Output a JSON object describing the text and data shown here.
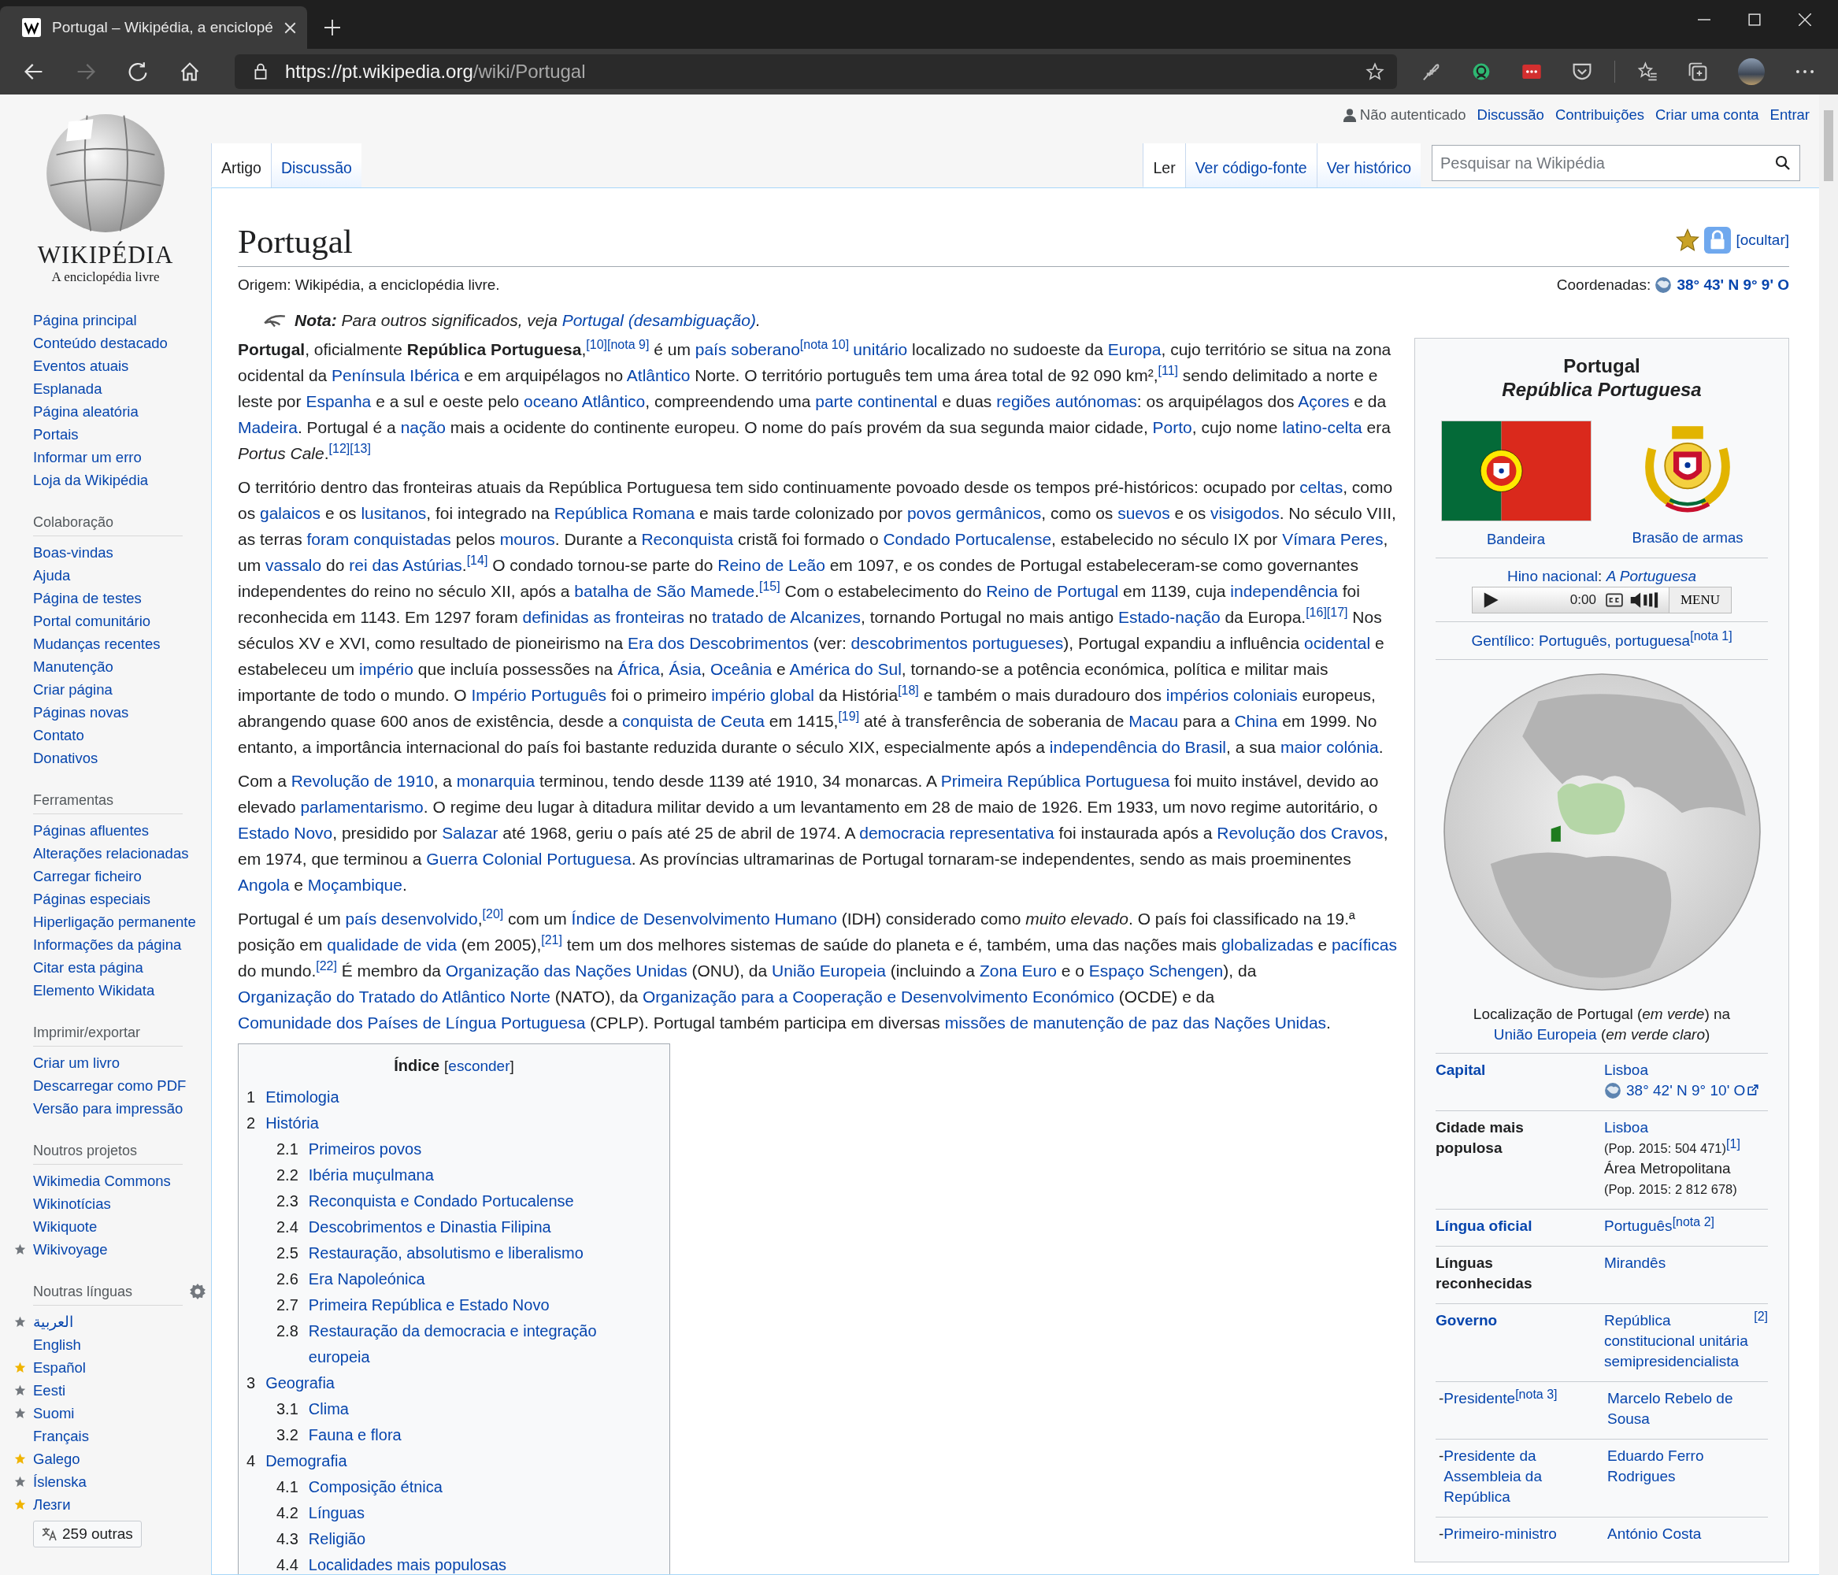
{
  "browser": {
    "tab": {
      "title": "Portugal – Wikipédia, a enciclopé"
    },
    "forward_disabled": true,
    "url": {
      "host": "https://pt.wikipedia.org",
      "path": "/wiki/Portugal"
    }
  },
  "personal": {
    "user": "Não autenticado",
    "links": [
      "Discussão",
      "Contribuições",
      "Criar uma conta",
      "Entrar"
    ]
  },
  "left_tabs": [
    {
      "label": "Artigo",
      "selected": true
    },
    {
      "label": "Discussão",
      "selected": false
    }
  ],
  "right_tabs": [
    {
      "label": "Ler",
      "selected": true
    },
    {
      "label": "Ver código-fonte",
      "selected": false
    },
    {
      "label": "Ver histórico",
      "selected": false
    }
  ],
  "search": {
    "placeholder": "Pesquisar na Wikipédia"
  },
  "sidebar": {
    "logo": {
      "wordmark": "WIKIPÉDIA",
      "tagline": "A enciclopédia livre"
    },
    "groups": [
      {
        "items": [
          {
            "label": "Página principal"
          },
          {
            "label": "Conteúdo destacado"
          },
          {
            "label": "Eventos atuais"
          },
          {
            "label": "Esplanada"
          },
          {
            "label": "Página aleatória"
          },
          {
            "label": "Portais"
          },
          {
            "label": "Informar um erro"
          },
          {
            "label": "Loja da Wikipédia"
          }
        ]
      },
      {
        "heading": "Colaboração",
        "items": [
          {
            "label": "Boas-vindas"
          },
          {
            "label": "Ajuda"
          },
          {
            "label": "Página de testes"
          },
          {
            "label": "Portal comunitário"
          },
          {
            "label": "Mudanças recentes"
          },
          {
            "label": "Manutenção"
          },
          {
            "label": "Criar página"
          },
          {
            "label": "Páginas novas"
          },
          {
            "label": "Contato"
          },
          {
            "label": "Donativos"
          }
        ]
      },
      {
        "heading": "Ferramentas",
        "items": [
          {
            "label": "Páginas afluentes"
          },
          {
            "label": "Alterações relacionadas"
          },
          {
            "label": "Carregar ficheiro"
          },
          {
            "label": "Páginas especiais"
          },
          {
            "label": "Hiperligação permanente"
          },
          {
            "label": "Informações da página"
          },
          {
            "label": "Citar esta página"
          },
          {
            "label": "Elemento Wikidata"
          }
        ]
      },
      {
        "heading": "Imprimir/exportar",
        "items": [
          {
            "label": "Criar um livro"
          },
          {
            "label": "Descarregar como PDF"
          },
          {
            "label": "Versão para impressão"
          }
        ]
      },
      {
        "heading": "Noutros projetos",
        "items": [
          {
            "label": "Wikimedia Commons"
          },
          {
            "label": "Wikinotícias"
          },
          {
            "label": "Wikiquote"
          },
          {
            "label": "Wikivoyage",
            "color": "#72777d"
          }
        ]
      },
      {
        "heading": "Noutras línguas",
        "settings": true,
        "more": "259 outras",
        "items": [
          {
            "label": "العربية",
            "color": "#72777d"
          },
          {
            "label": "English"
          },
          {
            "label": "Español",
            "color": "#f0b400"
          },
          {
            "label": "Eesti",
            "color": "#72777d"
          },
          {
            "label": "Suomi",
            "color": "#72777d"
          },
          {
            "label": "Français"
          },
          {
            "label": "Galego",
            "color": "#f0b400"
          },
          {
            "label": "Íslenska",
            "color": "#72777d"
          },
          {
            "label": "Лезги",
            "color": "#f0b400"
          }
        ]
      }
    ]
  },
  "article": {
    "title": "Portugal",
    "hide_link": "[ocultar]",
    "origin": "Origem: Wikipédia, a enciclopédia livre.",
    "coordinates": [
      "Coordenadas: ",
      {
        "kind": "coord",
        "text": "38° 43' N 9° 9' O"
      }
    ],
    "hatnote": [
      "**Nota:** Para outros significados, veja ",
      {
        "kind": "link",
        "text": "Portugal (desambiguação)"
      },
      "."
    ],
    "paragraphs": [
      [
        "**Portugal**, oficialmente **República Portuguesa**,",
        {
          "kind": "ref",
          "text": "[10]"
        },
        {
          "kind": "ref",
          "text": "[nota 9]"
        },
        " é um ",
        {
          "kind": "link",
          "text": "país soberano"
        },
        {
          "kind": "ref",
          "text": "[nota 10]"
        },
        {
          "kind": "link",
          "text": "unitário"
        },
        " localizado no sudoeste da ",
        {
          "kind": "link",
          "text": "Europa"
        },
        ", cujo território se situa na zona ocidental da ",
        {
          "kind": "link",
          "text": "Península Ibérica"
        },
        " e em arquipélagos no ",
        {
          "kind": "link",
          "text": "Atlântico"
        },
        " Norte. O território português tem uma área total de 92 090 km²,",
        {
          "kind": "ref",
          "text": "[11]"
        },
        " sendo delimitado a norte e leste por ",
        {
          "kind": "link",
          "text": "Espanha"
        },
        " e a sul e oeste pelo ",
        {
          "kind": "link",
          "text": "oceano Atlântico"
        },
        ", compreendendo uma ",
        {
          "kind": "link",
          "text": "parte continental"
        },
        " e duas ",
        {
          "kind": "link",
          "text": "regiões autónomas"
        },
        ": os arquipélagos dos ",
        {
          "kind": "link",
          "text": "Açores"
        },
        " e da ",
        {
          "kind": "link",
          "text": "Madeira"
        },
        ". Portugal é a ",
        {
          "kind": "link",
          "text": "nação"
        },
        " mais a ocidente do continente europeu. O nome do país provém da sua segunda maior cidade, ",
        {
          "kind": "link",
          "text": "Porto"
        },
        ", cujo nome ",
        {
          "kind": "link",
          "text": "latino-celta"
        },
        " era *Portus Cale*.",
        {
          "kind": "ref",
          "text": "[12]"
        },
        {
          "kind": "ref",
          "text": "[13]"
        }
      ],
      [
        "O território dentro das fronteiras atuais da República Portuguesa tem sido continuamente povoado desde os tempos pré-históricos: ocupado por ",
        {
          "kind": "link",
          "text": "celtas"
        },
        ", como os ",
        {
          "kind": "link",
          "text": "galaicos"
        },
        " e os ",
        {
          "kind": "link",
          "text": "lusitanos"
        },
        ", foi integrado na ",
        {
          "kind": "link",
          "text": "República Romana"
        },
        " e mais tarde colonizado por ",
        {
          "kind": "link",
          "text": "povos germânicos"
        },
        ", como os ",
        {
          "kind": "link",
          "text": "suevos"
        },
        " e os ",
        {
          "kind": "link",
          "text": "visigodos"
        },
        ". No século VIII, as terras ",
        {
          "kind": "link",
          "text": "foram conquistadas"
        },
        " pelos ",
        {
          "kind": "link",
          "text": "mouros"
        },
        ". Durante a ",
        {
          "kind": "link",
          "text": "Reconquista"
        },
        " cristã foi formado o ",
        {
          "kind": "link",
          "text": "Condado Portucalense"
        },
        ", estabelecido no século IX por ",
        {
          "kind": "link",
          "text": "Vímara Peres"
        },
        ", um ",
        {
          "kind": "link",
          "text": "vassalo"
        },
        " do ",
        {
          "kind": "link",
          "text": "rei das Astúrias"
        },
        ".",
        {
          "kind": "ref",
          "text": "[14]"
        },
        " O condado tornou-se parte do ",
        {
          "kind": "link",
          "text": "Reino de Leão"
        },
        " em 1097, e os condes de Portugal estabeleceram-se como governantes independentes do reino no século XII, após a ",
        {
          "kind": "link",
          "text": "batalha de São Mamede"
        },
        ".",
        {
          "kind": "ref",
          "text": "[15]"
        },
        " Com o estabelecimento do ",
        {
          "kind": "link",
          "text": "Reino de Portugal"
        },
        " em 1139, cuja ",
        {
          "kind": "link",
          "text": "independência"
        },
        " foi reconhecida em 1143. Em 1297 foram ",
        {
          "kind": "link",
          "text": "definidas as fronteiras"
        },
        " no ",
        {
          "kind": "link",
          "text": "tratado de Alcanizes"
        },
        ", tornando Portugal no mais antigo ",
        {
          "kind": "link",
          "text": "Estado-nação"
        },
        " da Europa.",
        {
          "kind": "ref",
          "text": "[16]"
        },
        {
          "kind": "ref",
          "text": "[17]"
        },
        " Nos séculos XV e XVI, como resultado de pioneirismo na ",
        {
          "kind": "link",
          "text": "Era dos Descobrimentos"
        },
        " (ver: ",
        {
          "kind": "link",
          "text": "descobrimentos portugueses"
        },
        "), Portugal expandiu a influência ",
        {
          "kind": "link",
          "text": "ocidental"
        },
        " e estabeleceu um ",
        {
          "kind": "link",
          "text": "império"
        },
        " que incluía possessões na ",
        {
          "kind": "link",
          "text": "África"
        },
        ", ",
        {
          "kind": "link",
          "text": "Ásia"
        },
        ", ",
        {
          "kind": "link",
          "text": "Oceânia"
        },
        " e ",
        {
          "kind": "link",
          "text": "América do Sul"
        },
        ", tornando-se a potência económica, política e militar mais importante de todo o mundo. O ",
        {
          "kind": "link",
          "text": "Império Português"
        },
        " foi o primeiro ",
        {
          "kind": "link",
          "text": "império global"
        },
        " da História",
        {
          "kind": "ref",
          "text": "[18]"
        },
        " e também o mais duradouro dos ",
        {
          "kind": "link",
          "text": "impérios coloniais"
        },
        " europeus, abrangendo quase 600 anos de existência, desde a ",
        {
          "kind": "link",
          "text": "conquista de Ceuta"
        },
        " em 1415,",
        {
          "kind": "ref",
          "text": "[19]"
        },
        " até à transferência de soberania de ",
        {
          "kind": "link",
          "text": "Macau"
        },
        " para a ",
        {
          "kind": "link",
          "text": "China"
        },
        " em 1999. No entanto, a importância internacional do país foi bastante reduzida durante o século XIX, especialmente após a ",
        {
          "kind": "link",
          "text": "independência do Brasil"
        },
        ", a sua ",
        {
          "kind": "link",
          "text": "maior colónia"
        },
        "."
      ],
      [
        "Com a ",
        {
          "kind": "link",
          "text": "Revolução de 1910"
        },
        ", a ",
        {
          "kind": "link",
          "text": "monarquia"
        },
        " terminou, tendo desde 1139 até 1910, 34 monarcas. A ",
        {
          "kind": "link",
          "text": "Primeira República Portuguesa"
        },
        " foi muito instável, devido ao elevado ",
        {
          "kind": "link",
          "text": "parlamentarismo"
        },
        ". O regime deu lugar à ditadura militar devido a um levantamento em 28 de maio de 1926. Em 1933, um novo regime autoritário, o ",
        {
          "kind": "link",
          "text": "Estado Novo"
        },
        ", presidido por ",
        {
          "kind": "link",
          "text": "Salazar"
        },
        " até 1968, geriu o país até 25 de abril de 1974. A ",
        {
          "kind": "link",
          "text": "democracia representativa"
        },
        " foi instaurada após a ",
        {
          "kind": "link",
          "text": "Revolução dos Cravos"
        },
        ", em 1974, que terminou a ",
        {
          "kind": "link",
          "text": "Guerra Colonial Portuguesa"
        },
        ". As províncias ultramarinas de Portugal tornaram-se independentes, sendo as mais proeminentes ",
        {
          "kind": "link",
          "text": "Angola"
        },
        " e ",
        {
          "kind": "link",
          "text": "Moçambique"
        },
        "."
      ],
      [
        "Portugal é um ",
        {
          "kind": "link",
          "text": "país desenvolvido"
        },
        ",",
        {
          "kind": "ref",
          "text": "[20]"
        },
        " com um ",
        {
          "kind": "link",
          "text": "Índice de Desenvolvimento Humano"
        },
        " (IDH) considerado como *muito elevado*. O país foi classificado na 19.ª posição em ",
        {
          "kind": "link",
          "text": "qualidade de vida"
        },
        " (em 2005),",
        {
          "kind": "ref",
          "text": "[21]"
        },
        " tem um dos melhores sistemas de saúde do planeta e é, também, uma das nações mais ",
        {
          "kind": "link",
          "text": "globalizadas"
        },
        " e ",
        {
          "kind": "link",
          "text": "pacíficas"
        },
        " do mundo.",
        {
          "kind": "ref",
          "text": "[22]"
        },
        " É membro da ",
        {
          "kind": "link",
          "text": "Organização das Nações Unidas"
        },
        " (ONU), da ",
        {
          "kind": "link",
          "text": "União Europeia"
        },
        " (incluindo a ",
        {
          "kind": "link",
          "text": "Zona Euro"
        },
        " e o ",
        {
          "kind": "link",
          "text": "Espaço Schengen"
        },
        "), da ",
        {
          "kind": "link",
          "text": "Organização do Tratado do Atlântico Norte"
        },
        " (NATO), da ",
        {
          "kind": "link",
          "text": "Organização para a Cooperação e Desenvolvimento Económico"
        },
        " (OCDE) e da ",
        {
          "kind": "link",
          "text": "Comunidade dos Países de Língua Portuguesa"
        },
        " (CPLP). Portugal também participa em diversas ",
        {
          "kind": "link",
          "text": "missões de manutenção de paz das Nações Unidas"
        },
        "."
      ]
    ],
    "toc": {
      "title": "Índice",
      "toggle": [
        "[",
        {
          "kind": "link",
          "text": "esconder"
        },
        "]"
      ],
      "items": [
        {
          "number": "1",
          "text": "Etimologia"
        },
        {
          "number": "2",
          "text": "História",
          "children": [
            {
              "number": "2.1",
              "text": "Primeiros povos"
            },
            {
              "number": "2.2",
              "text": "Ibéria muçulmana"
            },
            {
              "number": "2.3",
              "text": "Reconquista e Condado Portucalense"
            },
            {
              "number": "2.4",
              "text": "Descobrimentos e Dinastia Filipina"
            },
            {
              "number": "2.5",
              "text": "Restauração, absolutismo e liberalismo"
            },
            {
              "number": "2.6",
              "text": "Era Napoleónica"
            },
            {
              "number": "2.7",
              "text": "Primeira República e Estado Novo"
            },
            {
              "number": "2.8",
              "text": "Restauração da democracia e integração europeia"
            }
          ]
        },
        {
          "number": "3",
          "text": "Geografia",
          "children": [
            {
              "number": "3.1",
              "text": "Clima"
            },
            {
              "number": "3.2",
              "text": "Fauna e flora"
            }
          ]
        },
        {
          "number": "4",
          "text": "Demografia",
          "children": [
            {
              "number": "4.1",
              "text": "Composição étnica"
            },
            {
              "number": "4.2",
              "text": "Línguas"
            },
            {
              "number": "4.3",
              "text": "Religião"
            },
            {
              "number": "4.4",
              "text": "Localidades mais populosas"
            }
          ]
        }
      ]
    },
    "infobox": {
      "name": "Portugal",
      "official_name": "República Portuguesa",
      "flag_caption": "Bandeira",
      "arms_caption": "Brasão de armas",
      "anthem": [
        {
          "kind": "link",
          "text": "Hino nacional"
        },
        ": ",
        {
          "kind": "italic-link",
          "text": "A Portuguesa"
        }
      ],
      "audio": {
        "time": "0:00",
        "menu": "MENU"
      },
      "demonym": [
        {
          "kind": "link",
          "text": "Gentílico: Português, portuguesa"
        },
        {
          "kind": "ref",
          "text": "[nota 1]"
        }
      ],
      "map_caption": [
        "Localização de Portugal (*em verde*) na ",
        {
          "kind": "link",
          "text": "União Europeia"
        },
        " (*em verde claro*)"
      ],
      "rows": [
        {
          "kind": "main",
          "label": [
            {
              "kind": "link",
              "text": "Capital"
            }
          ],
          "value": [
            [
              {
                "kind": "link",
                "text": "Lisboa"
              }
            ],
            [
              {
                "kind": "coord-ext",
                "text": "38° 42' N 9° 10' O"
              }
            ]
          ]
        },
        {
          "kind": "main",
          "label": [
            "Cidade mais populosa"
          ],
          "value": [
            [
              {
                "kind": "link",
                "text": "Lisboa"
              }
            ],
            [
              {
                "kind": "small",
                "text": "(Pop. 2015: 504 471)"
              },
              {
                "kind": "ref",
                "text": "[1]"
              }
            ],
            [
              "Área Metropolitana"
            ],
            [
              {
                "kind": "small",
                "text": "(Pop. 2015: 2 812 678)"
              }
            ]
          ]
        },
        {
          "kind": "main",
          "label": [
            {
              "kind": "link",
              "text": "Língua oficial"
            }
          ],
          "value": [
            [
              {
                "kind": "link",
                "text": "Português"
              },
              {
                "kind": "ref",
                "text": "[nota 2]"
              }
            ]
          ]
        },
        {
          "kind": "main",
          "label": [
            "Línguas reconhecidas"
          ],
          "value": [
            [
              {
                "kind": "link",
                "text": "Mirandês"
              }
            ]
          ]
        },
        {
          "kind": "main",
          "label": [
            {
              "kind": "link",
              "text": "Governo"
            }
          ],
          "value": [
            [
              {
                "kind": "link",
                "text": "República constitucional unitária semipresidencialista"
              },
              {
                "kind": "ref",
                "text": "[2]"
              }
            ]
          ]
        },
        {
          "kind": "sub",
          "label": [
            "- ",
            {
              "kind": "link",
              "text": "Presidente"
            },
            {
              "kind": "ref",
              "text": "[nota 3]"
            }
          ],
          "value": [
            [
              {
                "kind": "link",
                "text": "Marcelo Rebelo de Sousa"
              }
            ]
          ]
        },
        {
          "kind": "sub",
          "label": [
            "- ",
            {
              "kind": "link",
              "text": "Presidente da Assembleia da República"
            }
          ],
          "value": [
            [
              {
                "kind": "link",
                "text": "Eduardo Ferro Rodrigues"
              }
            ]
          ]
        },
        {
          "kind": "sub",
          "label": [
            "- ",
            {
              "kind": "link",
              "text": "Primeiro-ministro"
            }
          ],
          "value": [
            [
              {
                "kind": "link",
                "text": "António Costa"
              }
            ]
          ]
        }
      ]
    }
  }
}
